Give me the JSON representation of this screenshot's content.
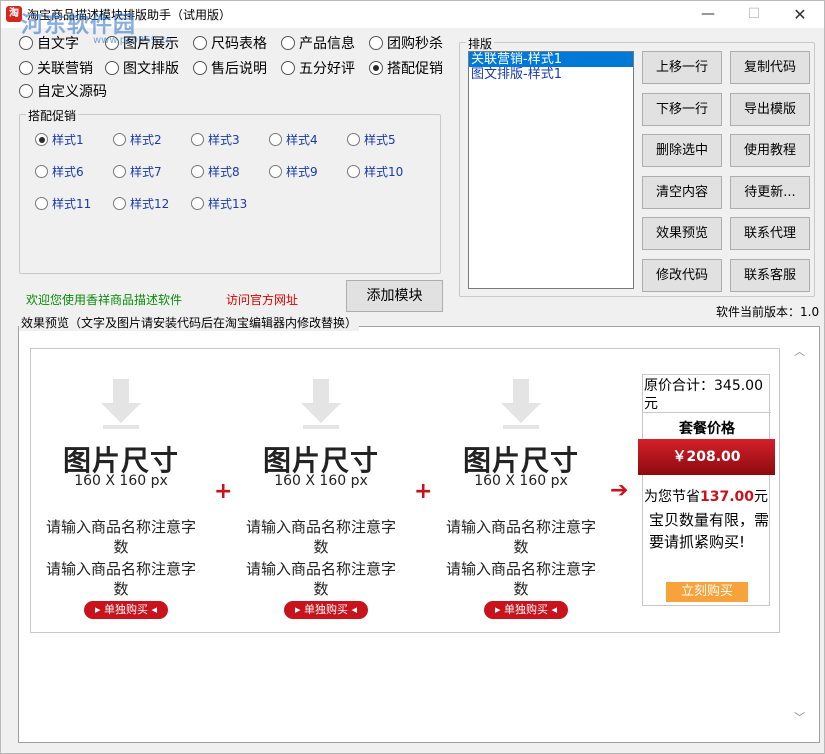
{
  "titlebar": {
    "title": "淘宝商品描述模块排版助手（试用版）",
    "app_icon_text": "淘",
    "watermark": "河东软件园",
    "watermark_sub": "www.pc0359.cn",
    "minimize": "—",
    "maximize": "☐",
    "close": "✕"
  },
  "modules": [
    {
      "label": "自文字",
      "checked": false
    },
    {
      "label": "图片展示",
      "checked": false
    },
    {
      "label": "尺码表格",
      "checked": false
    },
    {
      "label": "产品信息",
      "checked": false
    },
    {
      "label": "团购秒杀",
      "checked": false
    },
    {
      "label": "关联营销",
      "checked": false
    },
    {
      "label": "图文排版",
      "checked": false
    },
    {
      "label": "售后说明",
      "checked": false
    },
    {
      "label": "五分好评",
      "checked": false
    },
    {
      "label": "搭配促销",
      "checked": true
    },
    {
      "label": "自定义源码",
      "checked": false
    }
  ],
  "promo_group": {
    "label": "搭配促销",
    "styles": [
      "样式1",
      "样式2",
      "样式3",
      "样式4",
      "样式5",
      "样式6",
      "样式7",
      "样式8",
      "样式9",
      "样式10",
      "样式11",
      "样式12",
      "样式13"
    ],
    "selected": "样式1"
  },
  "layout_group": {
    "label": "排版",
    "items": [
      {
        "label": "关联营销-样式1",
        "selected": true
      },
      {
        "label": "图文排版-样式1",
        "selected": false
      }
    ]
  },
  "buttons": {
    "move_up": "上移一行",
    "copy_code": "复制代码",
    "move_down": "下移一行",
    "export_template": "导出模版",
    "delete_selected": "删除选中",
    "tutorial": "使用教程",
    "clear": "清空内容",
    "pending": "待更新...",
    "preview": "效果预览",
    "contact_agent": "联系代理",
    "modify_code": "修改代码",
    "contact_service": "联系客服",
    "add_module": "添加模块"
  },
  "links": {
    "welcome": "欢迎您使用香祥商品描述软件",
    "official_site": "访问官方网址"
  },
  "version": "软件当前版本：1.0",
  "preview": {
    "label": "效果预览（文字及图片请安装代码后在淘宝编辑器内修改替换）",
    "products": [
      {
        "ph_big": "图片尺寸",
        "ph_small": "160 X 160 px",
        "name1": "请输入商品名称注意字数",
        "name2": "请输入商品名称注意字数",
        "buy": "▸ 单独购买 ◂"
      },
      {
        "ph_big": "图片尺寸",
        "ph_small": "160 X 160 px",
        "name1": "请输入商品名称注意字数",
        "name2": "请输入商品名称注意字数",
        "buy": "▸ 单独购买 ◂"
      },
      {
        "ph_big": "图片尺寸",
        "ph_small": "160 X 160 px",
        "name1": "请输入商品名称注意字数",
        "name2": "请输入商品名称注意字数",
        "buy": "▸ 单独购买 ◂"
      }
    ],
    "plus": "+",
    "arrow": "➔",
    "summary": {
      "total": "原价合计：345.00元",
      "title": "套餐价格",
      "price": "￥208.00",
      "save_prefix": "为您节省",
      "save_amount": "137.00",
      "save_suffix": "元",
      "note": "宝贝数量有限，需要请抓紧购买!",
      "buy": "立刻购买"
    }
  },
  "colors": {
    "accent_red": "#c8121c",
    "link_green": "#0a8a0a",
    "selection_blue": "#0078d7",
    "buy_orange": "#f7a23a"
  }
}
